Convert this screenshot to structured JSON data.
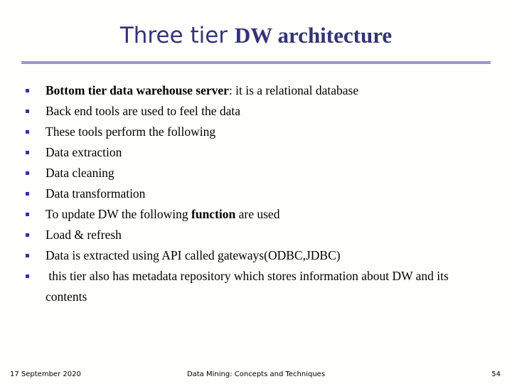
{
  "slide": {
    "title": {
      "plain_part": "Three tier ",
      "bold_part": "DW architecture",
      "color": "#333377"
    },
    "rule": {
      "color": "#9a9ac6"
    },
    "bullets": [
      {
        "marker": "square-bullet",
        "segments": [
          {
            "text": "Bottom tier data warehouse server",
            "bold": true
          },
          {
            "text": ": it is a relational database",
            "bold": false
          }
        ]
      },
      {
        "marker": "square-bullet",
        "segments": [
          {
            "text": "Back end tools are used to feel the data",
            "bold": false
          }
        ]
      },
      {
        "marker": "square-bullet",
        "segments": [
          {
            "text": "These tools perform the following",
            "bold": false
          }
        ]
      },
      {
        "marker": "square-bullet",
        "segments": [
          {
            "text": "Data extraction",
            "bold": false
          }
        ]
      },
      {
        "marker": "square-bullet",
        "segments": [
          {
            "text": "Data cleaning",
            "bold": false
          }
        ]
      },
      {
        "marker": "square-bullet",
        "segments": [
          {
            "text": "Data transformation",
            "bold": false
          }
        ]
      },
      {
        "marker": "square-bullet",
        "segments": [
          {
            "text": "To update DW the following ",
            "bold": false
          },
          {
            "text": "function",
            "bold": true
          },
          {
            "text": " are used",
            "bold": false
          }
        ]
      },
      {
        "marker": "square-bullet",
        "segments": [
          {
            "text": "Load & refresh",
            "bold": false
          }
        ]
      },
      {
        "marker": "square-bullet",
        "segments": [
          {
            "text": "Data is extracted using API called gateways(ODBC,JDBC)",
            "bold": false
          }
        ]
      },
      {
        "marker": "square-bullet",
        "segments": [
          {
            "text": " this tier also has metadata repository which stores information about DW and its contents",
            "bold": false
          }
        ]
      }
    ],
    "bullet_color": "#333399"
  },
  "footer": {
    "date": "17 September 2020",
    "center": "Data Mining: Concepts and Techniques",
    "page_number": "54"
  }
}
